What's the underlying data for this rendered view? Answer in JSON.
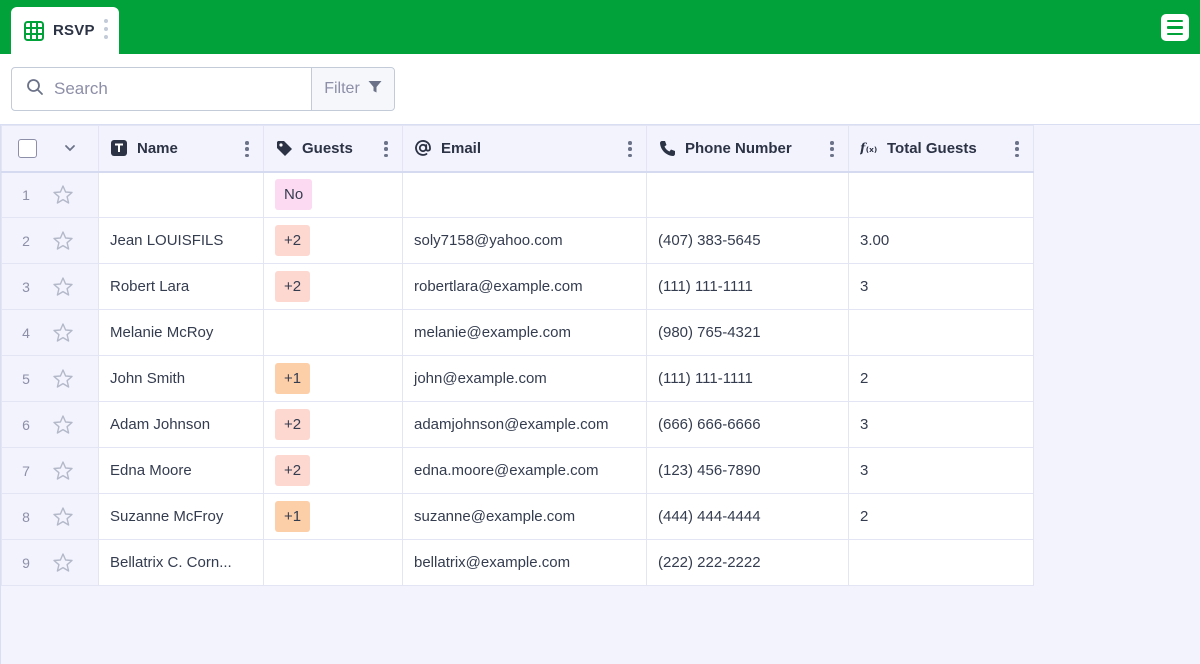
{
  "tab": {
    "label": "RSVP",
    "icon": "table-grid-icon"
  },
  "search": {
    "placeholder": "Search",
    "value": ""
  },
  "filter": {
    "label": "Filter"
  },
  "columns": [
    {
      "key": "name",
      "label": "Name",
      "icon": "text-type-icon"
    },
    {
      "key": "guests",
      "label": "Guests",
      "icon": "tag-icon"
    },
    {
      "key": "email",
      "label": "Email",
      "icon": "at-sign-icon"
    },
    {
      "key": "phone",
      "label": "Phone Number",
      "icon": "phone-icon"
    },
    {
      "key": "total",
      "label": "Total Guests",
      "icon": "formula-icon"
    }
  ],
  "rows": [
    {
      "num": "1",
      "name": "",
      "guests": "No",
      "email": "",
      "phone": "",
      "total": ""
    },
    {
      "num": "2",
      "name": "Jean LOUISFILS",
      "guests": "+2",
      "email": "soly7158@yahoo.com",
      "phone": "(407) 383-5645",
      "total": "3.00"
    },
    {
      "num": "3",
      "name": "Robert Lara",
      "guests": "+2",
      "email": "robertlara@example.com",
      "phone": "(111) 111-1111",
      "total": "3"
    },
    {
      "num": "4",
      "name": "Melanie McRoy",
      "guests": "",
      "email": "melanie@example.com",
      "phone": "(980) 765-4321",
      "total": ""
    },
    {
      "num": "5",
      "name": "John Smith",
      "guests": "+1",
      "email": "john@example.com",
      "phone": "(111) 111-1111",
      "total": "2"
    },
    {
      "num": "6",
      "name": "Adam Johnson",
      "guests": "+2",
      "email": "adamjohnson@example.com",
      "phone": "(666) 666-6666",
      "total": "3"
    },
    {
      "num": "7",
      "name": "Edna Moore",
      "guests": "+2",
      "email": "edna.moore@example.com",
      "phone": "(123) 456-7890",
      "total": "3"
    },
    {
      "num": "8",
      "name": "Suzanne McFroy",
      "guests": "+1",
      "email": "suzanne@example.com",
      "phone": "(444) 444-4444",
      "total": "2"
    },
    {
      "num": "9",
      "name": "Bellatrix C. Corn...",
      "guests": "",
      "email": "bellatrix@example.com",
      "phone": "(222) 222-2222",
      "total": ""
    }
  ],
  "badge_colors": {
    "No": "#fcdaf2",
    "+2": "#fdd8d0",
    "+1": "#fdcfa8"
  },
  "colors": {
    "brand": "#01a23a",
    "header_bg": "#f3f3fe"
  }
}
